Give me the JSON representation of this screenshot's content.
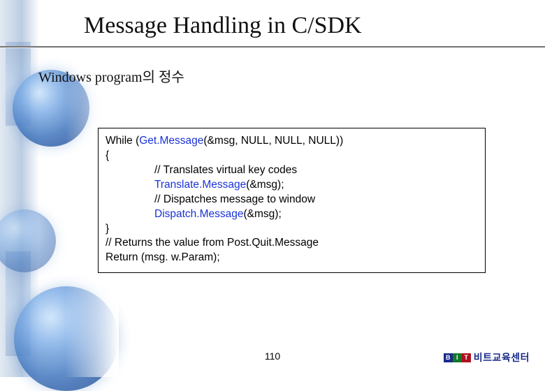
{
  "title": "Message Handling in C/SDK",
  "subtitle": "Windows program의 정수",
  "code": {
    "line1_a": "While (",
    "line1_kw": "Get.Message",
    "line1_b": "(&msg, NULL, NULL, NULL))",
    "line2": "{",
    "line3": "// Translates virtual key codes",
    "line4_kw": "Translate.Message",
    "line4_b": "(&msg);",
    "line5": "// Dispatches message to window",
    "line6_kw": "Dispatch.Message",
    "line6_b": "(&msg);",
    "line7": "}",
    "line8": "// Returns the value from Post.Quit.Message",
    "line9": "Return (msg. w.Param);"
  },
  "page_number": "110",
  "brand": {
    "logo_b": "B",
    "logo_i": "I",
    "logo_t": "T",
    "text": "비트교육센터"
  }
}
